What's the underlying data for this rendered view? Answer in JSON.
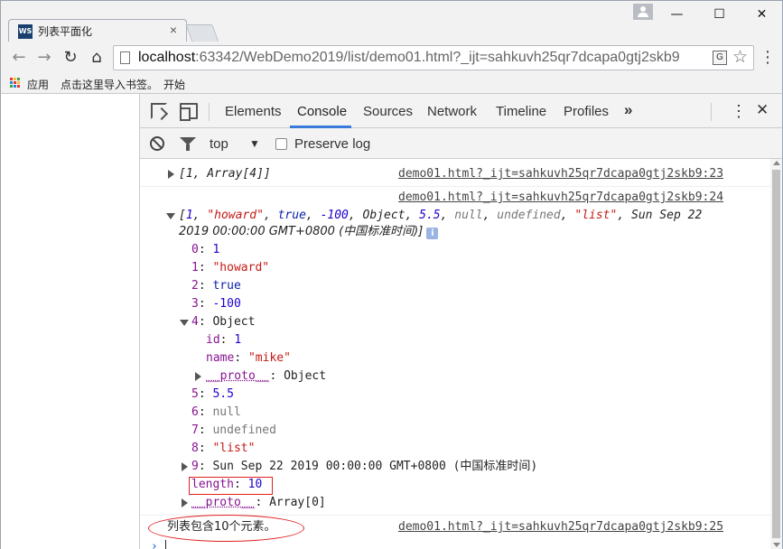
{
  "window": {
    "tab_title": "列表平面化",
    "tab_favicon_text": "WS",
    "minimize_glyph": "—",
    "maximize_glyph": "☐",
    "close_glyph": "✕"
  },
  "toolbar": {
    "url_host": "localhost",
    "url_rest": ":63342/WebDemo2019/list/demo01.html?_ijt=sahkuvh25qr7dcapa0gtj2skb9",
    "translate_glyph": "G"
  },
  "bookmarks": {
    "apps": "应用",
    "import": "点击这里导入书签。",
    "start": "开始"
  },
  "devtools": {
    "tabs": [
      "Elements",
      "Console",
      "Sources",
      "Network",
      "Timeline",
      "Profiles"
    ],
    "active_tab": "Console",
    "more_glyph": "»",
    "context": "top",
    "preserve_log": "Preserve log",
    "accent_color": "#3879d9"
  },
  "console": {
    "entry1": {
      "text": "[1, Array[4]]",
      "source": "demo01.html?_ijt=sahkuvh25qr7dcapa0gtj2skb9:23"
    },
    "entry2": {
      "source": "demo01.html?_ijt=sahkuvh25qr7dcapa0gtj2skb9:24",
      "summary_parts": {
        "open": "[",
        "v0": "1",
        "v1": "\"howard\"",
        "v2": "true",
        "v3": "-100",
        "v4": "Object",
        "v5": "5.5",
        "v6": "null",
        "v7": "undefined",
        "v8": "\"list\"",
        "v9": "Sun Sep 22",
        "line2": "2019 00:00:00 GMT+0800 (中国标准时间)]",
        "comma": ", "
      },
      "info_glyph": "i",
      "items": [
        {
          "key": "0",
          "value": "1",
          "type": "num"
        },
        {
          "key": "1",
          "value": "\"howard\"",
          "type": "str"
        },
        {
          "key": "2",
          "value": "true",
          "type": "kw"
        },
        {
          "key": "3",
          "value": "-100",
          "type": "num"
        },
        {
          "key": "4",
          "value": "Object",
          "type": "plain"
        },
        {
          "key": "id",
          "value": "1",
          "type": "num"
        },
        {
          "key": "name",
          "value": "\"mike\"",
          "type": "str"
        },
        {
          "key": "__proto__",
          "value": "Object",
          "type": "plain"
        },
        {
          "key": "5",
          "value": "5.5",
          "type": "num"
        },
        {
          "key": "6",
          "value": "null",
          "type": "gray"
        },
        {
          "key": "7",
          "value": "undefined",
          "type": "gray"
        },
        {
          "key": "8",
          "value": "\"list\"",
          "type": "str"
        },
        {
          "key": "9",
          "value": "Sun Sep 22 2019 00:00:00 GMT+0800 (中国标准时间)",
          "type": "plain"
        },
        {
          "key": "length",
          "value": "10",
          "type": "num"
        },
        {
          "key": "__proto__",
          "value": "Array[0]",
          "type": "plain"
        }
      ]
    },
    "entry3": {
      "text": "列表包含10个元素。",
      "source": "demo01.html?_ijt=sahkuvh25qr7dcapa0gtj2skb9:25"
    },
    "prompt_glyph": "›"
  }
}
